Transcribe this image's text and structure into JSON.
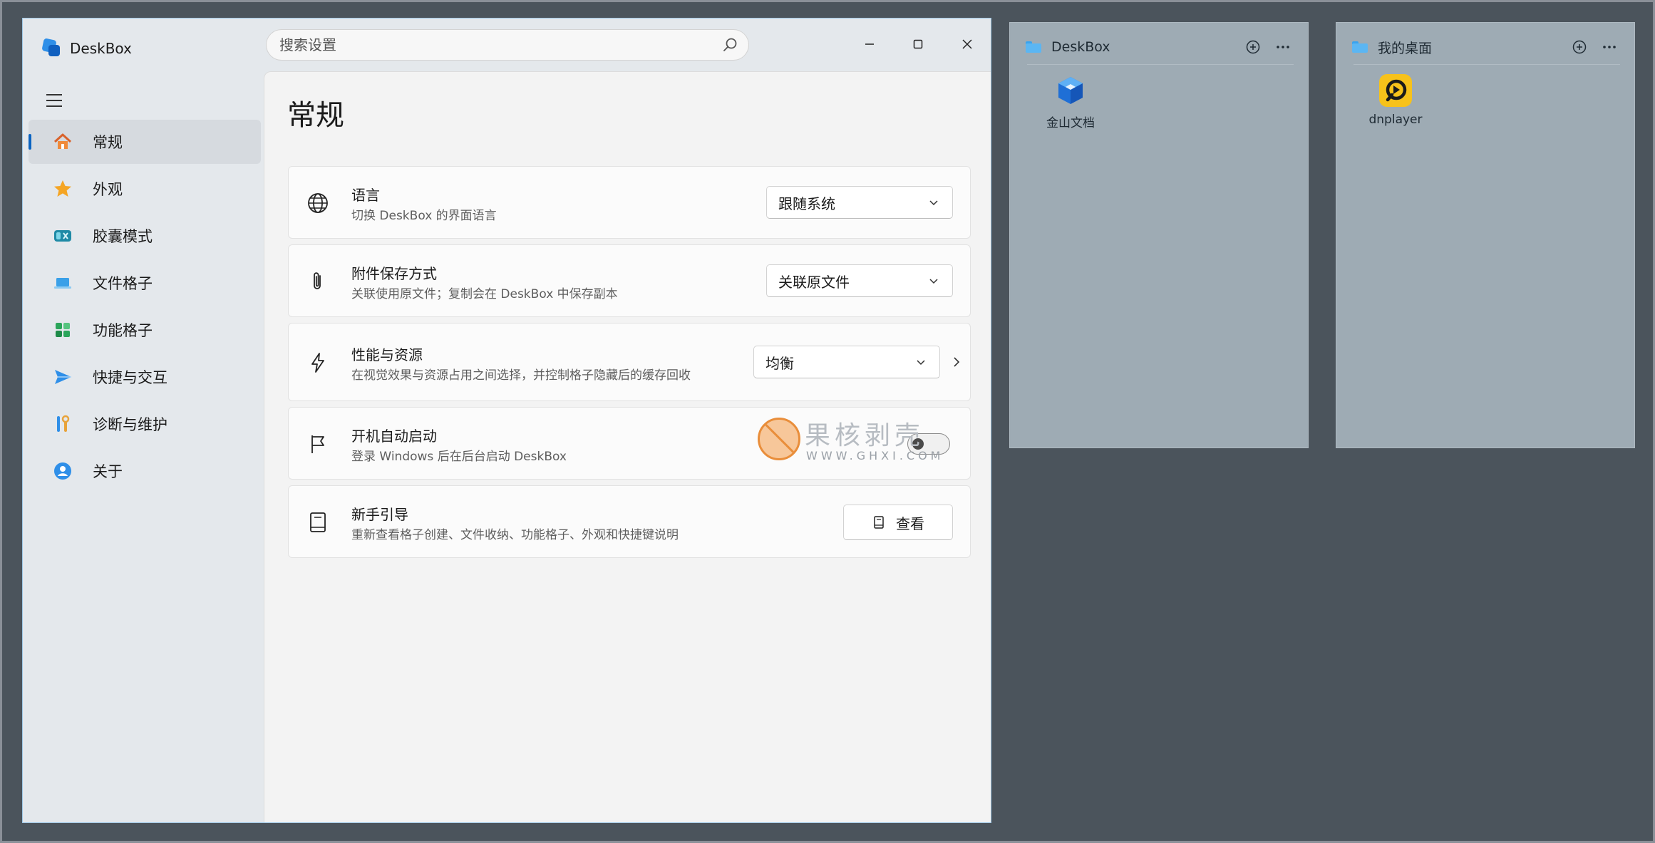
{
  "app": {
    "name": "DeskBox"
  },
  "search": {
    "placeholder": "搜索设置"
  },
  "sidebar": {
    "items": [
      {
        "label": "常规",
        "icon": "home-icon",
        "active": true
      },
      {
        "label": "外观",
        "icon": "star-icon"
      },
      {
        "label": "胶囊模式",
        "icon": "capsule-icon"
      },
      {
        "label": "文件格子",
        "icon": "laptop-icon"
      },
      {
        "label": "功能格子",
        "icon": "grid-blocks-icon"
      },
      {
        "label": "快捷与交互",
        "icon": "send-icon"
      },
      {
        "label": "诊断与维护",
        "icon": "tools-icon"
      },
      {
        "label": "关于",
        "icon": "info-icon"
      }
    ]
  },
  "page": {
    "title": "常规"
  },
  "settings": {
    "language": {
      "title": "语言",
      "desc": "切换 DeskBox 的界面语言",
      "value": "跟随系统",
      "icon": "globe-icon"
    },
    "attachment": {
      "title": "附件保存方式",
      "desc": "关联使用原文件；复制会在 DeskBox 中保存副本",
      "value": "关联原文件",
      "icon": "paperclip-icon"
    },
    "performance": {
      "title": "性能与资源",
      "desc": "在视觉效果与资源占用之间选择，并控制格子隐藏后的缓存回收",
      "value": "均衡",
      "icon": "lightning-icon"
    },
    "autostart": {
      "title": "开机自动启动",
      "desc": "登录 Windows 后在后台启动 DeskBox",
      "enabled": false,
      "icon": "flag-icon"
    },
    "guide": {
      "title": "新手引导",
      "desc": "重新查看格子创建、文件收纳、功能格子、外观和快捷键说明",
      "button": "查看",
      "icon": "book-icon"
    }
  },
  "watermark": {
    "text": "果核剥壳",
    "sub": "WWW.GHXI.COM"
  },
  "panels": [
    {
      "title": "DeskBox",
      "tiles": [
        {
          "label": "金山文档",
          "icon": "kingsoft-docs-icon"
        }
      ]
    },
    {
      "title": "我的桌面",
      "tiles": [
        {
          "label": "dnplayer",
          "icon": "dnplayer-icon"
        }
      ]
    }
  ],
  "colors": {
    "accent": "#0a64c2",
    "desktop": "#4b545c",
    "panel": "#9eabb4"
  }
}
